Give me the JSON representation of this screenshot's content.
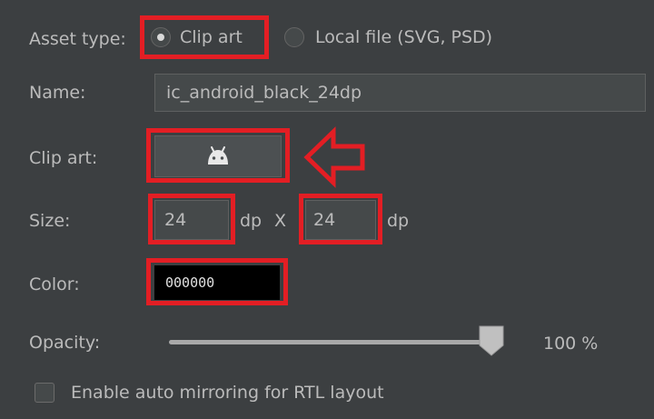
{
  "asset_type": {
    "label": "Asset type:",
    "options": [
      {
        "label": "Clip art",
        "selected": true
      },
      {
        "label": "Local file (SVG, PSD)",
        "selected": false
      }
    ]
  },
  "name": {
    "label": "Name:",
    "value": "ic_android_black_24dp"
  },
  "clip_art": {
    "label": "Clip art:",
    "icon": "android-icon"
  },
  "size": {
    "label": "Size:",
    "width": "24",
    "width_unit": "dp",
    "separator": "X",
    "height": "24",
    "height_unit": "dp"
  },
  "color": {
    "label": "Color:",
    "value": "000000",
    "swatch": "#000000"
  },
  "opacity": {
    "label": "Opacity:",
    "percent": 100,
    "value_text": "100 %"
  },
  "mirroring": {
    "label": "Enable auto mirroring for RTL layout",
    "checked": false
  },
  "colors": {
    "background": "#3c3f41",
    "highlight": "#e31e24"
  }
}
